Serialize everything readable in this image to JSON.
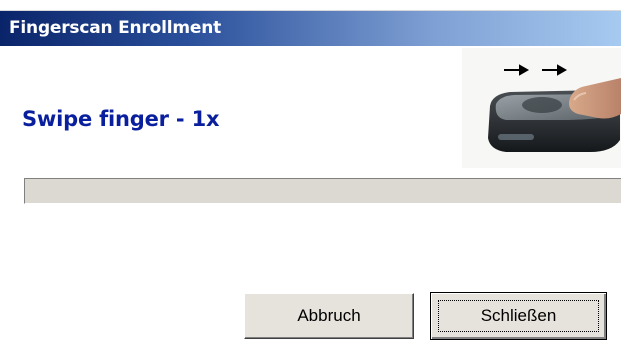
{
  "window": {
    "title": "Fingerscan Enrollment"
  },
  "instruction": {
    "text": "Swipe finger - 1x"
  },
  "illustration": {
    "icon": "fingerprint-scanner-swipe-illustration",
    "arrows": "→ →"
  },
  "progress": {
    "fraction": 0
  },
  "buttons": {
    "abort_label": "Abbruch",
    "close_label": "Schließen"
  },
  "colors": {
    "title_gradient_start": "#0a246a",
    "title_gradient_end": "#a6caf0",
    "instruction_text": "#0a1f9e",
    "button_face": "#e6e2dc",
    "progress_track": "#dcd8d2"
  }
}
